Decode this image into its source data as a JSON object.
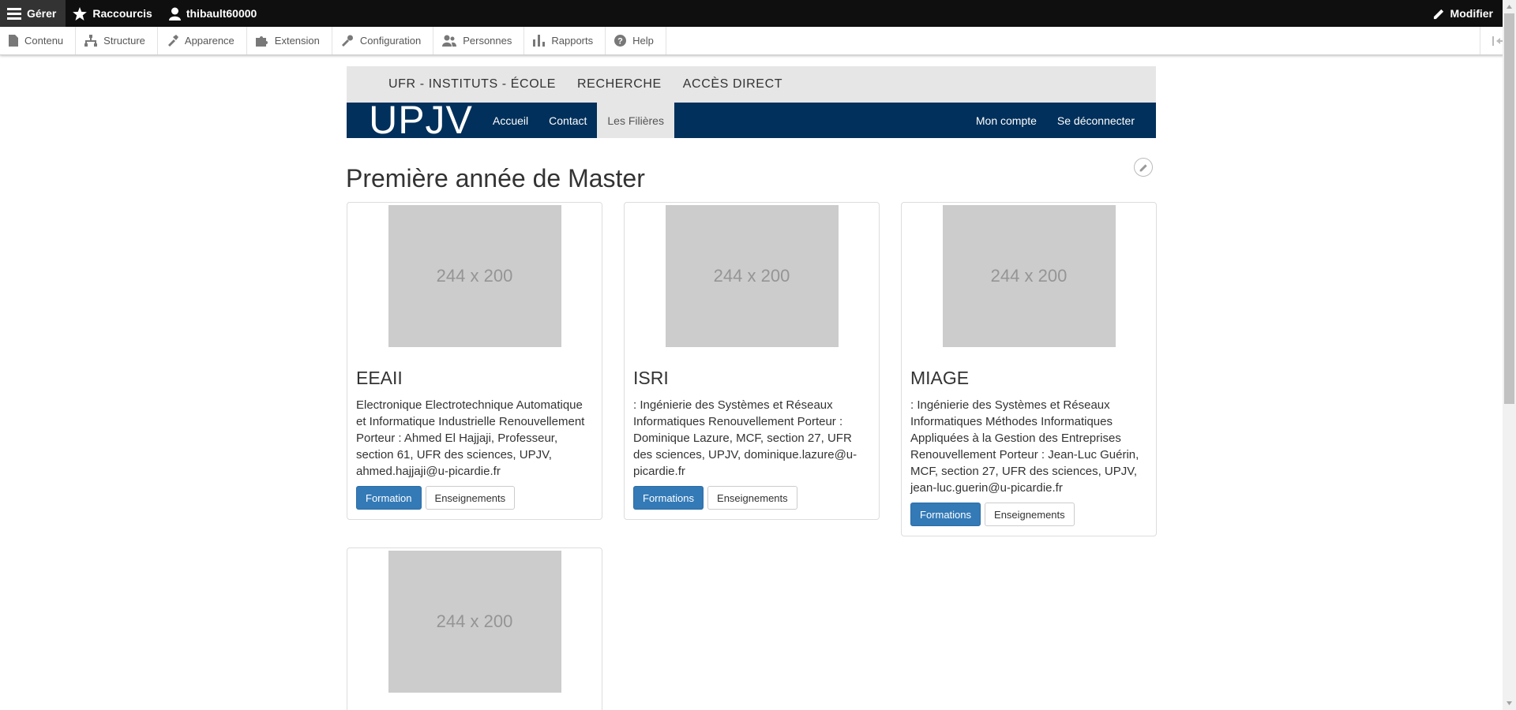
{
  "toolbar": {
    "manage": "Gérer",
    "shortcuts": "Raccourcis",
    "user": "thibault60000",
    "edit": "Modifier"
  },
  "tray": {
    "items": [
      "Contenu",
      "Structure",
      "Apparence",
      "Extension",
      "Configuration",
      "Personnes",
      "Rapports",
      "Help"
    ]
  },
  "site": {
    "top_menu": [
      "UFR - INSTITUTS - ÉCOLE",
      "RECHERCHE",
      "ACCÈS DIRECT"
    ],
    "logo": "UPJV",
    "nav": [
      "Accueil",
      "Contact",
      "Les Filières"
    ],
    "nav_right": [
      "Mon compte",
      "Se déconnecter"
    ],
    "colors": {
      "navbar": "#00305b",
      "top_menu": "#e6e6e6",
      "primary": "#337ab7"
    }
  },
  "page": {
    "title": "Première année de Master"
  },
  "cards": [
    {
      "image": "244 x 200",
      "title": "EEAII",
      "text": "Electronique Electrotechnique Automatique et Informatique Industrielle Renouvellement Porteur : Ahmed El Hajjaji, Professeur, section 61, UFR des sciences, UPJV, ahmed.hajjaji@u-picardie.fr",
      "primary": "Formation",
      "secondary": "Enseignements"
    },
    {
      "image": "244 x 200",
      "title": "ISRI",
      "text": ": Ingénierie des Systèmes et Réseaux Informatiques Renouvellement Porteur : Dominique Lazure, MCF, section 27, UFR des sciences, UPJV, dominique.lazure@u-picardie.fr",
      "primary": "Formations",
      "secondary": "Enseignements"
    },
    {
      "image": "244 x 200",
      "title": "MIAGE",
      "text": ": Ingénierie des Systèmes et Réseaux Informatiques Méthodes Informatiques Appliquées à la Gestion des Entreprises Renouvellement Porteur : Jean-Luc Guérin, MCF, section 27, UFR des sciences, UPJV, jean-luc.guerin@u-picardie.fr",
      "primary": "Formations",
      "secondary": "Enseignements"
    },
    {
      "image": "244 x 200"
    }
  ]
}
